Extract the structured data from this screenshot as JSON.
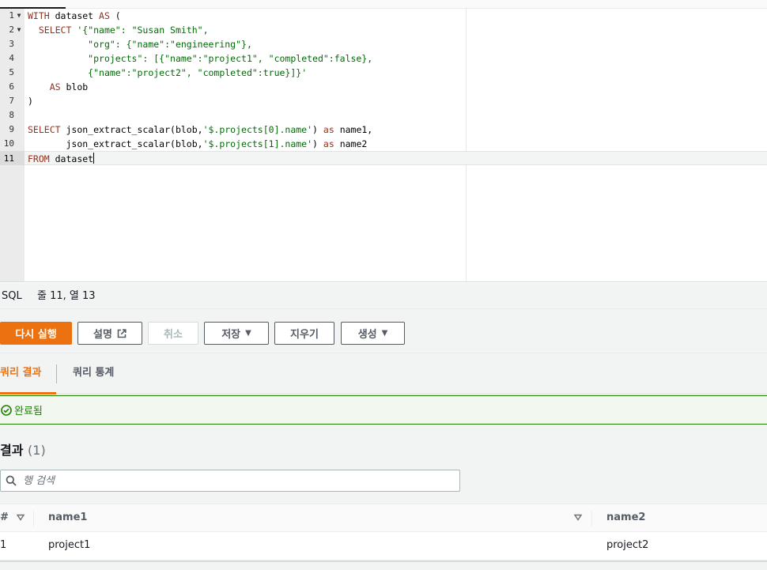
{
  "editor": {
    "lines": [
      {
        "n": "1",
        "fold": "▼"
      },
      {
        "n": "2",
        "fold": "▼"
      },
      {
        "n": "3",
        "fold": ""
      },
      {
        "n": "4",
        "fold": ""
      },
      {
        "n": "5",
        "fold": ""
      },
      {
        "n": "6",
        "fold": ""
      },
      {
        "n": "7",
        "fold": ""
      },
      {
        "n": "8",
        "fold": ""
      },
      {
        "n": "9",
        "fold": ""
      },
      {
        "n": "10",
        "fold": ""
      },
      {
        "n": "11",
        "fold": ""
      }
    ],
    "code": {
      "l1": {
        "kw_with": "WITH",
        "t1": " dataset ",
        "kw_as": "AS",
        "t2": " ("
      },
      "l2": {
        "indent": "  ",
        "kw_select": "SELECT",
        "t1": " ",
        "str": "'{\"name\": \"Susan Smith\","
      },
      "l3": {
        "indent": "           ",
        "str": "\"org\": {\"name\":\"engineering\"},"
      },
      "l4": {
        "indent": "           ",
        "str": "\"projects\": [{\"name\":\"project1\", \"completed\":false},"
      },
      "l5": {
        "indent": "           ",
        "str": "{\"name\":\"project2\", \"completed\":true}]}'"
      },
      "l6": {
        "indent": "    ",
        "kw_as": "AS",
        "t1": " blob"
      },
      "l7": {
        "t1": ")"
      },
      "l9": {
        "kw_select": "SELECT",
        "t1": " json_extract_scalar(blob,",
        "str": "'$.projects[0].name'",
        "t2": ") ",
        "kw_as": "as",
        "t3": " name1,"
      },
      "l10": {
        "indent": "       ",
        "t1": "json_extract_scalar(blob,",
        "str": "'$.projects[1].name'",
        "t2": ") ",
        "kw_as": "as",
        "t3": " name2"
      },
      "l11": {
        "kw_from": "FROM",
        "t1": " dataset"
      }
    }
  },
  "status": {
    "language": "SQL",
    "cursor_position": "줄 11, 열 13"
  },
  "toolbar": {
    "run_again": "다시 실행",
    "explain": "설명",
    "cancel": "취소",
    "save": "저장",
    "clear": "지우기",
    "create": "생성"
  },
  "tabs": [
    {
      "label": "쿼리 결과",
      "active": true
    },
    {
      "label": "쿼리 통계",
      "active": false
    }
  ],
  "alert": {
    "text": "완료됨",
    "color": "#1d8102"
  },
  "results": {
    "title": "결과",
    "count": "(1)",
    "search_placeholder": "행 검색",
    "columns": [
      "#",
      "name1",
      "name2"
    ],
    "rows": [
      {
        "index": "1",
        "name1": "project1",
        "name2": "project2"
      }
    ]
  },
  "colors": {
    "primary": "#ec7211",
    "success": "#1d8102",
    "text": "#16191f"
  }
}
